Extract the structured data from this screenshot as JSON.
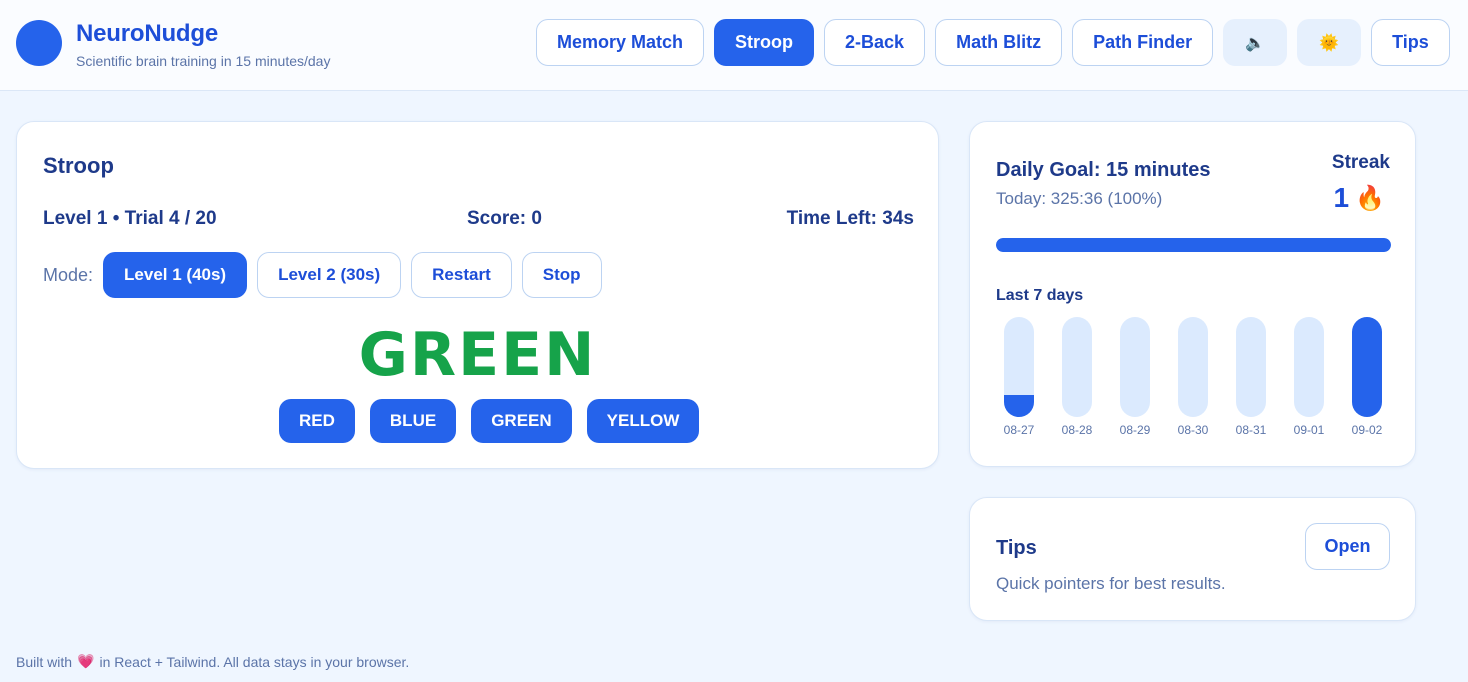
{
  "header": {
    "title": "NeuroNudge",
    "subtitle": "Scientific brain training in 15 minutes/day",
    "nav": [
      {
        "label": "Memory Match",
        "active": false
      },
      {
        "label": "Stroop",
        "active": true
      },
      {
        "label": "2-Back",
        "active": false
      },
      {
        "label": "Math Blitz",
        "active": false
      },
      {
        "label": "Path Finder",
        "active": false
      }
    ],
    "sound_icon": "speaker-icon",
    "sound_glyph": "🔈",
    "theme_icon": "sun-icon",
    "theme_glyph": "🌞",
    "tips_label": "Tips"
  },
  "game": {
    "title": "Stroop",
    "level_trial": "Level 1 • Trial 4 / 20",
    "score": "Score: 0",
    "time_left": "Time Left: 34s",
    "mode_label": "Mode:",
    "modes": [
      "Level 1 (40s)",
      "Level 2 (30s)"
    ],
    "active_mode": 0,
    "restart_label": "Restart",
    "stop_label": "Stop",
    "word": "GREEN",
    "word_color": "#16a34a",
    "answers": [
      "RED",
      "BLUE",
      "GREEN",
      "YELLOW"
    ]
  },
  "goal": {
    "title": "Daily Goal: 15 minutes",
    "today": "Today: 325:36 (100%)",
    "progress": 1.0,
    "streak_label": "Streak",
    "streak_value": "1",
    "streak_glyph": "🔥",
    "week_label": "Last 7 days",
    "days": [
      {
        "date": "08-27",
        "fraction": 0.22
      },
      {
        "date": "08-28",
        "fraction": 0
      },
      {
        "date": "08-29",
        "fraction": 0
      },
      {
        "date": "08-30",
        "fraction": 0
      },
      {
        "date": "08-31",
        "fraction": 0
      },
      {
        "date": "09-01",
        "fraction": 0
      },
      {
        "date": "09-02",
        "fraction": 1.0
      }
    ]
  },
  "tips": {
    "title": "Tips",
    "description": "Quick pointers for best results.",
    "open_label": "Open"
  },
  "footer": {
    "prefix": "Built with",
    "heart": "💗",
    "suffix": "in React + Tailwind. All data stays in your browser."
  },
  "colors": {
    "accent": "#2563eb",
    "text": "#1e3a8a",
    "muted": "#5b74a8",
    "background": "#eff6ff"
  }
}
